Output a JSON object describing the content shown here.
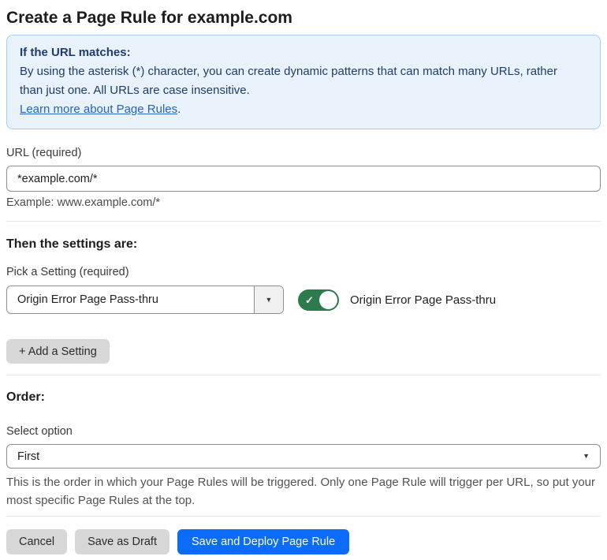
{
  "page": {
    "title": "Create a Page Rule for example.com"
  },
  "info_box": {
    "heading": "If the URL matches:",
    "body": "By using the asterisk (*) character, you can create dynamic patterns that can match many URLs, rather than just one. All URLs are case insensitive.",
    "link": "Learn more about Page Rules",
    "link_suffix": "."
  },
  "url_field": {
    "label": "URL (required)",
    "value": "*example.com/*",
    "helper": "Example: www.example.com/*"
  },
  "settings_section": {
    "heading": "Then the settings are:",
    "picker_label": "Pick a Setting (required)",
    "picker_value": "Origin Error Page Pass-thru",
    "toggle_state": "on",
    "toggle_check": "✓",
    "toggle_label": "Origin Error Page Pass-thru",
    "add_button": "+ Add a Setting"
  },
  "order_section": {
    "heading": "Order:",
    "select_label": "Select option",
    "select_value": "First",
    "helper": "This is the order in which your Page Rules will be triggered. Only one Page Rule will trigger per URL, so put your most specific Page Rules at the top."
  },
  "footer": {
    "cancel": "Cancel",
    "save_draft": "Save as Draft",
    "save_deploy": "Save and Deploy Page Rule"
  },
  "icons": {
    "chevron_down": "▼"
  },
  "colors": {
    "accent_blue": "#0b6cfb",
    "link_blue": "#2563c4",
    "info_bg": "#e9f2fb",
    "info_border": "#a9cdf0",
    "info_text": "#1e3c6e",
    "toggle_green": "#2d7a4d"
  }
}
